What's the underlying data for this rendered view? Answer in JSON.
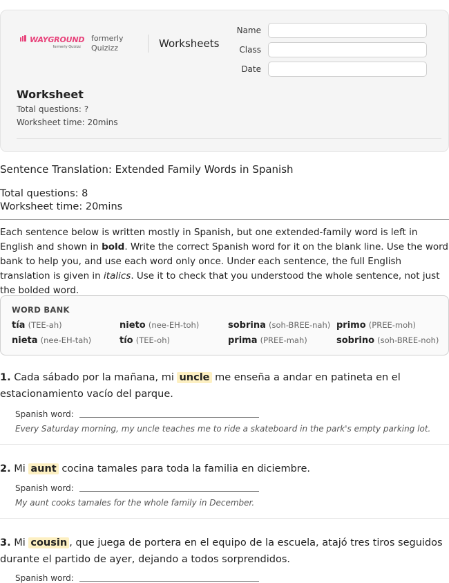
{
  "brand": {
    "logo_text": "WAYGROUND",
    "logo_sub": "formerly Quizizz",
    "formerly_label": "formerly Quizizz",
    "product": "Worksheets"
  },
  "fields": [
    {
      "label": "Name",
      "value": ""
    },
    {
      "label": "Class",
      "value": ""
    },
    {
      "label": "Date",
      "value": ""
    }
  ],
  "card": {
    "heading": "Worksheet",
    "total_questions": "Total questions: ?",
    "worksheet_time": "Worksheet time: 20mins"
  },
  "doc": {
    "title": "Sentence Translation: Extended Family Words in Spanish",
    "total_questions": "Total questions: 8",
    "worksheet_time": "Worksheet time: 20mins",
    "instructions": {
      "part1": "Each sentence below is written mostly in Spanish, but one extended-family word is left in English and shown in ",
      "bold": "bold",
      "part2": ". Write the correct Spanish word for it on the blank line. Use the word bank to help you, and use each word only once. Under each sentence, the full English translation is given in ",
      "italic": "italics",
      "part3": ". Use it to check that you understood the whole sentence, not just the bolded word."
    }
  },
  "word_bank": {
    "title": "WORD BANK",
    "words": [
      {
        "word": "tía",
        "pron": "(TEE-ah)"
      },
      {
        "word": "nieto",
        "pron": "(nee-EH-toh)"
      },
      {
        "word": "sobrina",
        "pron": "(soh-BREE-nah)"
      },
      {
        "word": "primo",
        "pron": "(PREE-moh)"
      },
      {
        "word": "nieta",
        "pron": "(nee-EH-tah)"
      },
      {
        "word": "tío",
        "pron": "(TEE-oh)"
      },
      {
        "word": "prima",
        "pron": "(PREE-mah)"
      },
      {
        "word": "sobrino",
        "pron": "(soh-BREE-noh)"
      }
    ]
  },
  "answer_label": "Spanish word:",
  "questions": [
    {
      "num": "1.",
      "before": "Cada sábado por la mañana, mi",
      "highlight": "uncle",
      "after": "me enseña a andar en patineta en el estacionamiento vacío del parque.",
      "translation": "Every Saturday morning, my uncle teaches me to ride a skateboard in the park's empty parking lot."
    },
    {
      "num": "2.",
      "before": "Mi",
      "highlight": "aunt",
      "after": "cocina tamales para toda la familia en diciembre.",
      "translation": "My aunt cooks tamales for the whole family in December."
    },
    {
      "num": "3.",
      "before": "Mi",
      "highlight": "cousin",
      "after": ", que juega de portera en el equipo de la escuela, atajó tres tiros seguidos durante el partido de ayer, dejando a todos sorprendidos.",
      "translation": ""
    }
  ],
  "colors": {
    "brand_pink": "#e8437b",
    "highlight": "#fdf0c2"
  }
}
